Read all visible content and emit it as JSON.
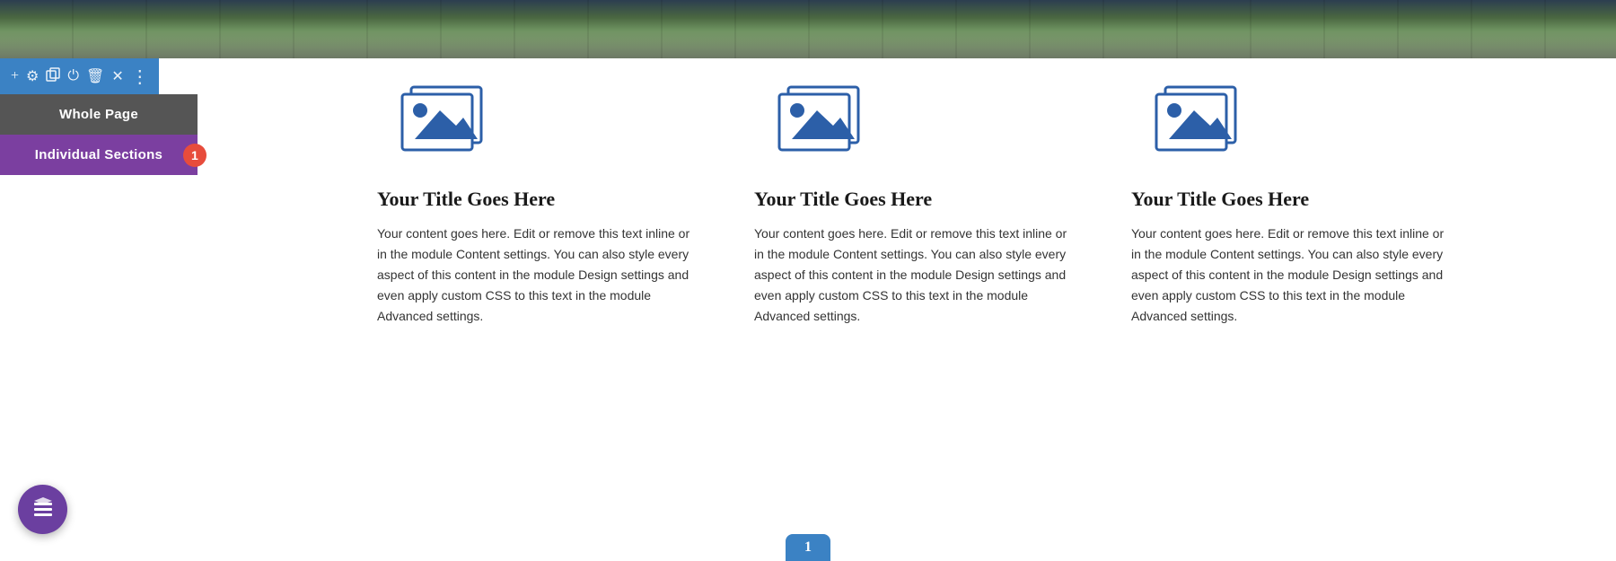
{
  "top_banner": {
    "alt": "Wooden bridge landscape photo"
  },
  "toolbar": {
    "icons": [
      {
        "name": "add-icon",
        "symbol": "+"
      },
      {
        "name": "settings-icon",
        "symbol": "⚙"
      },
      {
        "name": "duplicate-icon",
        "symbol": "⧉"
      },
      {
        "name": "power-icon",
        "symbol": "⏻"
      },
      {
        "name": "trash-icon",
        "symbol": "🗑"
      },
      {
        "name": "close-icon",
        "symbol": "✕"
      },
      {
        "name": "more-icon",
        "symbol": "⋮"
      }
    ]
  },
  "sidebar": {
    "whole_page_label": "Whole Page",
    "individual_sections_label": "Individual Sections",
    "badge": "1"
  },
  "columns": [
    {
      "title": "Your Title Goes Here",
      "body": "Your content goes here. Edit or remove this text inline or in the module Content settings. You can also style every aspect of this content in the module Design settings and even apply custom CSS to this text in the module Advanced settings."
    },
    {
      "title": "Your Title Goes Here",
      "body": "Your content goes here. Edit or remove this text inline or in the module Content settings. You can also style every aspect of this content in the module Design settings and even apply custom CSS to this text in the module Advanced settings."
    },
    {
      "title": "Your Title Goes Here",
      "body": "Your content goes here. Edit or remove this text inline or in the module Content settings. You can also style every aspect of this content in the module Design settings and even apply custom CSS to this text in the module Advanced settings."
    }
  ],
  "fab": {
    "label": "layers-icon"
  },
  "pagination": {
    "current": "1"
  },
  "colors": {
    "toolbar_bg": "#3b82c4",
    "whole_page_bg": "#555555",
    "individual_sections_bg": "#7b3fa0",
    "badge_bg": "#e74c3c",
    "fab_bg": "#6b3fa0",
    "pagination_bg": "#3b82c4",
    "icon_color": "#2c5fa8"
  }
}
